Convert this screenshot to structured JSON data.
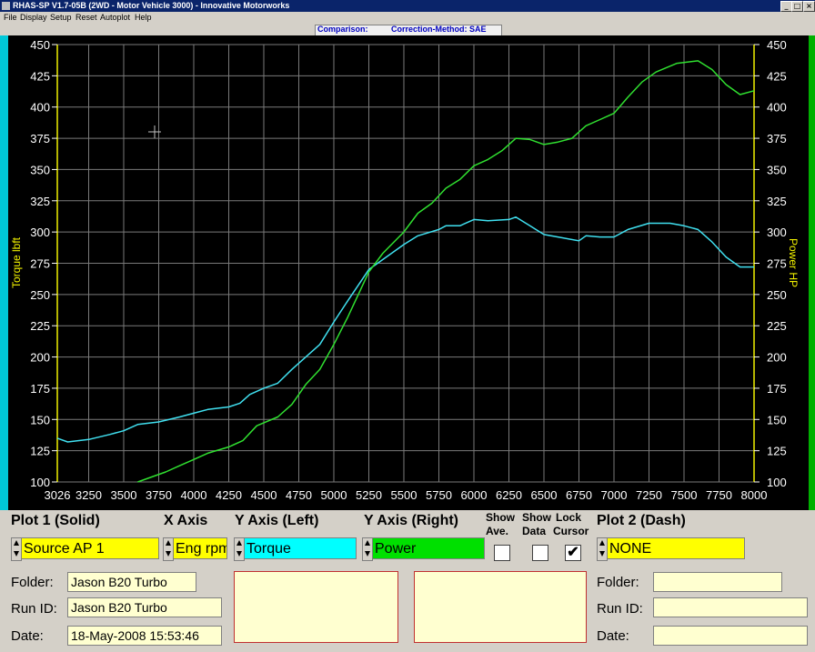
{
  "window": {
    "title": "RHAS-SP V1.7-05B  (2WD - Motor Vehicle 3000) - Innovative Motorworks",
    "min_glyph": "_",
    "max_glyph": "□",
    "close_glyph": "×"
  },
  "menu": [
    "File",
    "Display",
    "Setup",
    "Reset",
    "Autoplot",
    "Help"
  ],
  "comparison": {
    "label": "Comparison:",
    "method": "Correction-Method: SAE"
  },
  "chart_data": {
    "type": "line",
    "x_ticks": [
      "3026",
      "3250",
      "3500",
      "3750",
      "4000",
      "4250",
      "4500",
      "4750",
      "5000",
      "5250",
      "5500",
      "5750",
      "6000",
      "6250",
      "6500",
      "6750",
      "7000",
      "7250",
      "7500",
      "7750",
      "8000"
    ],
    "y_ticks": [
      "100",
      "125",
      "150",
      "175",
      "200",
      "225",
      "250",
      "275",
      "300",
      "325",
      "350",
      "375",
      "400",
      "425",
      "450"
    ],
    "ylabel_left": "Torque lbft",
    "ylabel_right": "Power HP",
    "xlim": [
      3026,
      8000
    ],
    "ylim": [
      100,
      450
    ],
    "grid": true,
    "colors": {
      "torque": "#40e0f0",
      "power": "#30e030",
      "grid": "#7a7a7a",
      "text": "#ffffff",
      "label": "#f0f000"
    },
    "series": [
      {
        "key": "torque",
        "points": [
          [
            3026,
            135
          ],
          [
            3100,
            132
          ],
          [
            3250,
            134
          ],
          [
            3400,
            138
          ],
          [
            3500,
            141
          ],
          [
            3600,
            146
          ],
          [
            3750,
            148
          ],
          [
            3900,
            152
          ],
          [
            4000,
            155
          ],
          [
            4100,
            158
          ],
          [
            4250,
            160
          ],
          [
            4330,
            163
          ],
          [
            4400,
            170
          ],
          [
            4500,
            175
          ],
          [
            4600,
            179
          ],
          [
            4700,
            190
          ],
          [
            4800,
            200
          ],
          [
            4900,
            210
          ],
          [
            5000,
            228
          ],
          [
            5100,
            245
          ],
          [
            5250,
            270
          ],
          [
            5400,
            282
          ],
          [
            5500,
            290
          ],
          [
            5600,
            297
          ],
          [
            5750,
            302
          ],
          [
            5800,
            305
          ],
          [
            5900,
            305
          ],
          [
            6000,
            310
          ],
          [
            6100,
            309
          ],
          [
            6250,
            310
          ],
          [
            6300,
            312
          ],
          [
            6400,
            305
          ],
          [
            6500,
            298
          ],
          [
            6600,
            296
          ],
          [
            6750,
            293
          ],
          [
            6800,
            297
          ],
          [
            6900,
            296
          ],
          [
            7000,
            296
          ],
          [
            7100,
            302
          ],
          [
            7250,
            307
          ],
          [
            7400,
            307
          ],
          [
            7500,
            305
          ],
          [
            7600,
            302
          ],
          [
            7700,
            292
          ],
          [
            7800,
            280
          ],
          [
            7900,
            272
          ],
          [
            8000,
            272
          ]
        ]
      },
      {
        "key": "power",
        "points": [
          [
            3600,
            100
          ],
          [
            3700,
            104
          ],
          [
            3800,
            108
          ],
          [
            3900,
            113
          ],
          [
            4000,
            118
          ],
          [
            4100,
            123
          ],
          [
            4250,
            128
          ],
          [
            4350,
            133
          ],
          [
            4450,
            145
          ],
          [
            4600,
            152
          ],
          [
            4700,
            162
          ],
          [
            4800,
            178
          ],
          [
            4900,
            190
          ],
          [
            5000,
            210
          ],
          [
            5100,
            232
          ],
          [
            5250,
            268
          ],
          [
            5350,
            283
          ],
          [
            5500,
            300
          ],
          [
            5600,
            315
          ],
          [
            5700,
            323
          ],
          [
            5800,
            335
          ],
          [
            5900,
            342
          ],
          [
            6000,
            353
          ],
          [
            6100,
            358
          ],
          [
            6200,
            365
          ],
          [
            6300,
            375
          ],
          [
            6400,
            374
          ],
          [
            6500,
            370
          ],
          [
            6600,
            372
          ],
          [
            6700,
            375
          ],
          [
            6800,
            385
          ],
          [
            6900,
            390
          ],
          [
            7000,
            395
          ],
          [
            7100,
            408
          ],
          [
            7200,
            420
          ],
          [
            7300,
            428
          ],
          [
            7450,
            435
          ],
          [
            7600,
            437
          ],
          [
            7700,
            430
          ],
          [
            7800,
            418
          ],
          [
            7900,
            410
          ],
          [
            8000,
            413
          ]
        ]
      }
    ]
  },
  "controls": {
    "plot1_header": "Plot 1 (Solid)",
    "xaxis_header": "X Axis",
    "yleft_header": "Y Axis (Left)",
    "yright_header": "Y Axis (Right)",
    "show_ave_line1": "Show",
    "show_ave_line2": "Ave.",
    "show_data_line1": "Show",
    "show_data_line2": "Data",
    "lock_cursor_line1": "Lock",
    "lock_cursor_line2": "Cursor",
    "plot2_header": "Plot 2 (Dash)",
    "plot1_source": "Source AP 1",
    "xaxis_value": "Eng rpm",
    "yleft_value": "Torque",
    "yright_value": "Power",
    "plot2_value": "NONE",
    "lock_cursor_check": "✔"
  },
  "run1": {
    "folder_label": "Folder:",
    "folder": "Jason B20 Turbo",
    "runid_label": "Run ID:",
    "runid": "Jason B20 Turbo",
    "date_label": "Date:",
    "date": "18-May-2008  15:53:46"
  },
  "run2": {
    "folder_label": "Folder:",
    "folder": "",
    "runid_label": "Run ID:",
    "runid": "",
    "date_label": "Date:",
    "date": ""
  },
  "swatch_colors": {
    "yellow": "#ffff00",
    "cyan": "#00ffff",
    "green": "#00e000"
  }
}
